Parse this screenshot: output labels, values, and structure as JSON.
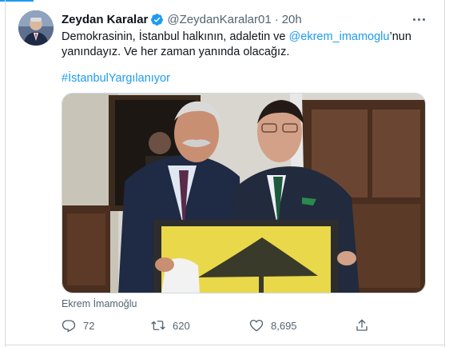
{
  "tweet": {
    "author_name": "Zeydan Karalar",
    "handle": "@ZeydanKaralar01",
    "separator": "·",
    "time": "20h",
    "text_before": "Demokrasinin, İstanbul halkının, adaletin ve ",
    "mention": "@ekrem_imamoglu",
    "text_after": "’nun yanındayız. Ve her zaman yanında olacağız.",
    "hashtag": "#İstanbulYargılanıyor",
    "media_tag": "Ekrem İmamoğlu"
  },
  "actions": {
    "replies": "72",
    "retweets": "620",
    "likes": "8,695"
  },
  "icons": {
    "verified": "verified-badge-icon",
    "more": "more-horizontal-icon",
    "reply": "reply-icon",
    "retweet": "retweet-icon",
    "like": "heart-icon",
    "share": "share-icon"
  },
  "colors": {
    "accent": "#1d9bf0",
    "secondary_text": "#536471",
    "primary_text": "#0f1419"
  }
}
